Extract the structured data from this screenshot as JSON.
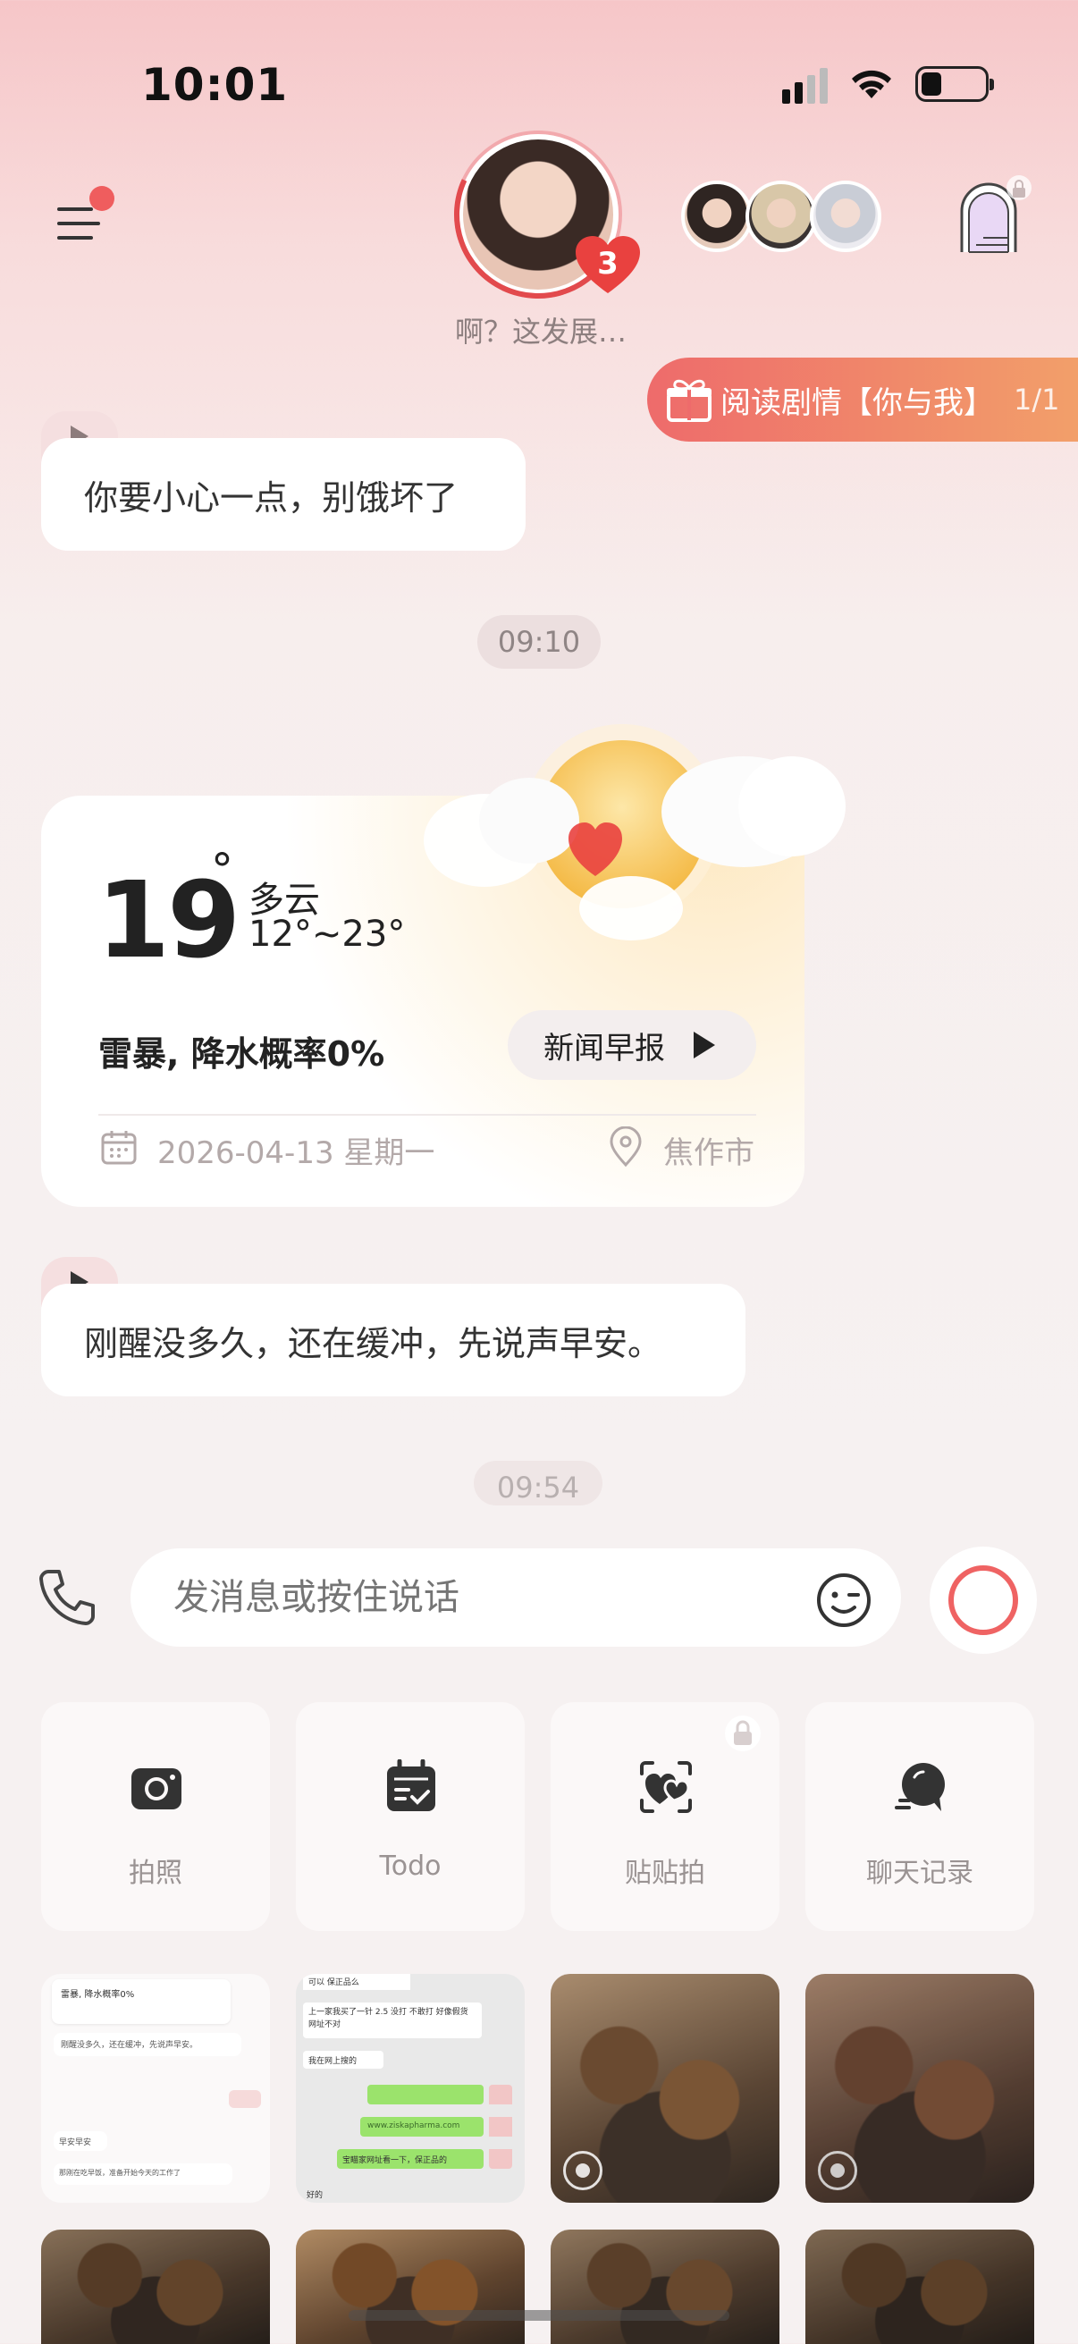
{
  "status_bar": {
    "time": "10:01"
  },
  "header": {
    "unread_count": "3",
    "avatar_caption": "啊？这发展…"
  },
  "story_banner": {
    "label": "阅读剧情【你与我】",
    "count": "1/1"
  },
  "chat": {
    "msg1": "你要小心一点，别饿坏了",
    "time1": "09:10",
    "msg2": "刚醒没多久，还在缓冲，先说声早安。",
    "time2": "09:54"
  },
  "weather": {
    "temp": "19",
    "degree": "°",
    "condition": "多云",
    "range": "12°~23°",
    "alert": "雷暴, 降水概率0%",
    "news_button": "新闻早报",
    "date": "2026-04-13 星期一",
    "city": "焦作市"
  },
  "input": {
    "placeholder": "发消息或按住说话"
  },
  "quick_actions": [
    {
      "label": "拍照",
      "icon": "camera-icon"
    },
    {
      "label": "Todo",
      "icon": "todo-icon"
    },
    {
      "label": "贴贴拍",
      "icon": "couple-photo-icon"
    },
    {
      "label": "聊天记录",
      "icon": "chat-history-icon"
    }
  ],
  "gallery": {
    "shot1_lines": [
      "雷暴, 降水概率0%",
      "刚醒没多久，还在缓冲，先说声早安。",
      "早安早安",
      "那刚在吃早饭，准备开始今天的工作了"
    ],
    "shot2_lines": [
      "可以 保正品么",
      "上一家我买了一针 2.5 没打 不敢打 好像假货网址不对",
      "我在网上搜的",
      "www.ziskapharma.com",
      "宝瞄家网址看一下，保正品的",
      "好的"
    ]
  },
  "colors": {
    "accent": "#ef5d5e",
    "banner_start": "#ee6b6b",
    "banner_end": "#f2a06a"
  }
}
